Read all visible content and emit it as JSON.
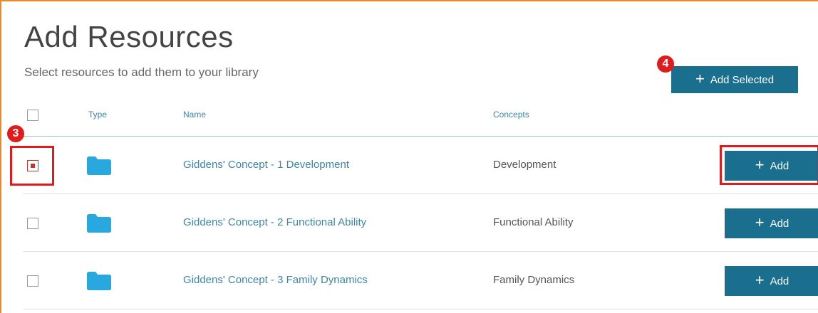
{
  "page": {
    "title": "Add Resources",
    "subtitle": "Select resources to add them to your library"
  },
  "toolbar": {
    "add_selected_label": "Add Selected",
    "plus_glyph": "+"
  },
  "callouts": {
    "step_3": "3",
    "step_4": "4"
  },
  "table": {
    "headers": {
      "type": "Type",
      "name": "Name",
      "concepts": "Concepts"
    },
    "rows": [
      {
        "name": "Giddens' Concept - 1 Development",
        "concept": "Development",
        "add_label": "Add",
        "type_icon": "folder-icon"
      },
      {
        "name": "Giddens' Concept - 2 Functional Ability",
        "concept": "Functional Ability",
        "add_label": "Add",
        "type_icon": "folder-icon"
      },
      {
        "name": "Giddens' Concept - 3 Family Dynamics",
        "concept": "Family Dynamics",
        "add_label": "Add",
        "type_icon": "folder-icon"
      }
    ]
  },
  "colors": {
    "accent": "#1a6e8e",
    "link": "#3d87a6",
    "folder": "#29a8e0",
    "callout": "#e11b1b",
    "frame": "#e98b2a"
  }
}
